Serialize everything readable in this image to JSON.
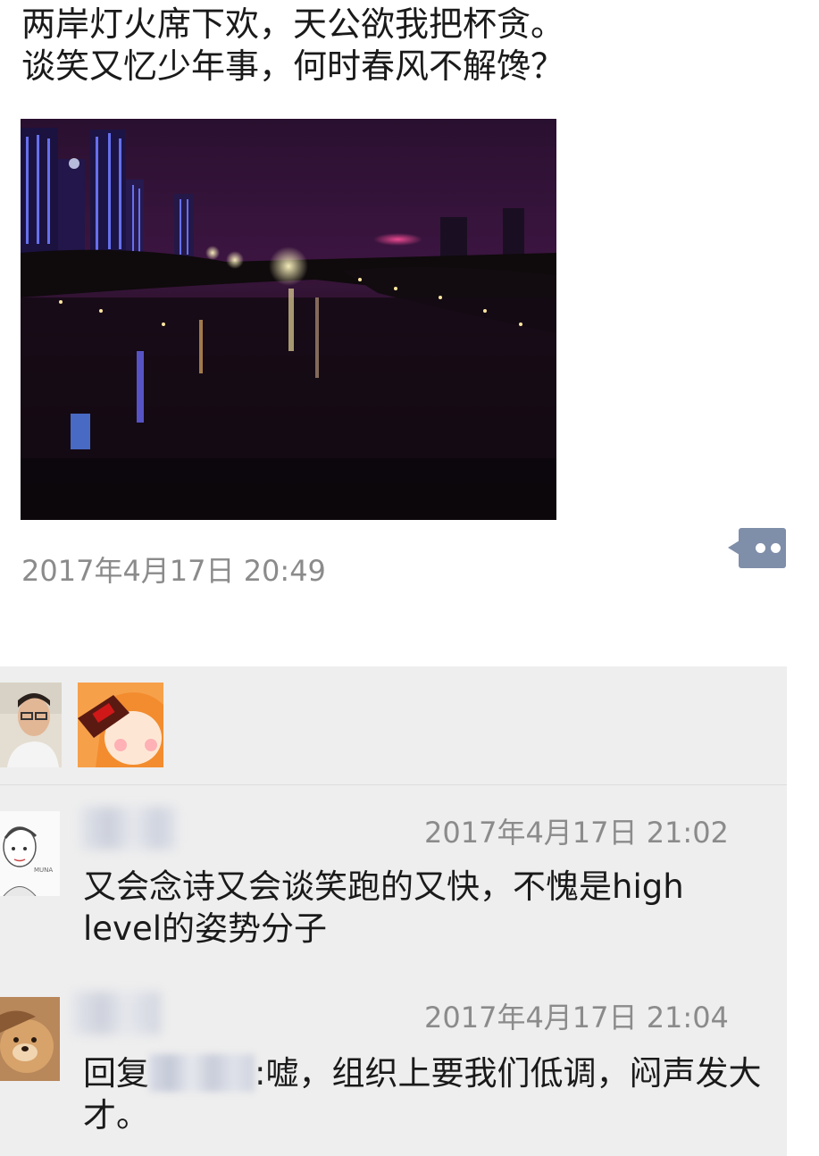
{
  "post": {
    "lines": [
      "两岸灯火席下欢，天公欲我把杯贪。",
      "谈笑又忆少年事，何时春风不解馋？"
    ],
    "timestamp": "2017年4月17日 20:49",
    "comment_button_icon": "comment-dots-icon"
  },
  "likes": {
    "avatars": [
      "avatar-man-glasses",
      "avatar-anime-girl-cola"
    ]
  },
  "comments": [
    {
      "avatar": "avatar-sketch-boy",
      "time": "2017年4月17日 21:02",
      "text": "又会念诗又会谈笑跑的又快，不愧是high level的姿势分子"
    },
    {
      "avatar": "avatar-dog",
      "time": "2017年4月17日 21:04",
      "reply_prefix": "回复",
      "text_after_name": ":嘘，组织上要我们低调，闷声发大才。"
    }
  ],
  "colors": {
    "timestamp": "#8b8b8b",
    "comment_button": "#7f8ea9",
    "panel_bg": "#eeeeee",
    "text": "#1a1a1a"
  }
}
